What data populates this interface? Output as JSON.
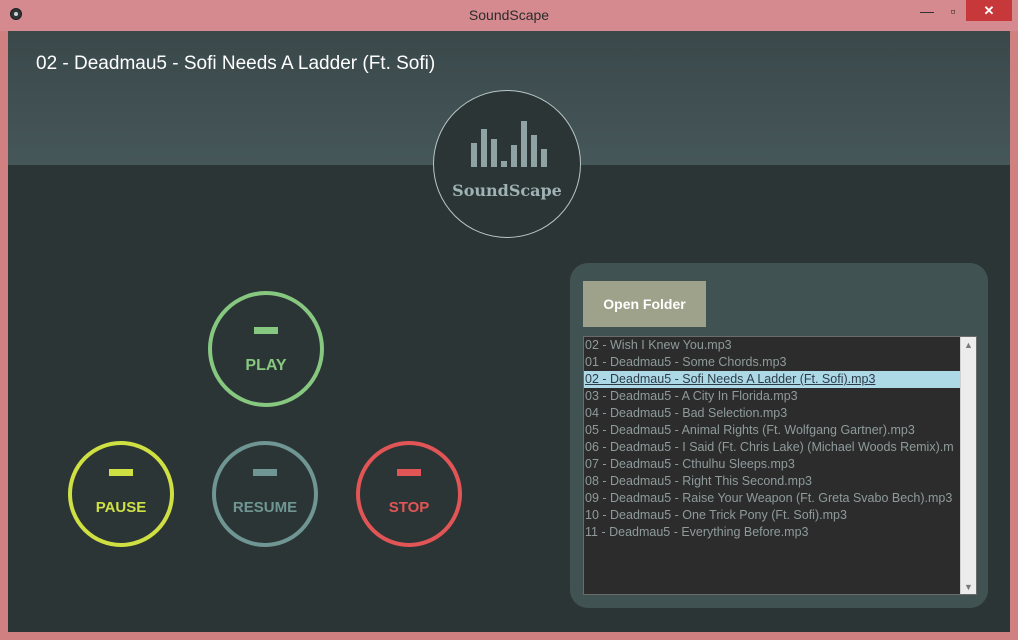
{
  "window": {
    "title": "SoundScape",
    "icons": {
      "app": "app-icon",
      "minimize": "minimize-icon",
      "maximize": "maximize-icon",
      "close": "close-icon"
    },
    "minimize_glyph": "—",
    "maximize_glyph": "▫",
    "close_glyph": "✕"
  },
  "header": {
    "now_playing": "02 - Deadmau5 - Sofi Needs A Ladder (Ft. Sofi)"
  },
  "logo": {
    "text": "SoundScape",
    "icon": "equalizer-bars-icon"
  },
  "controls": {
    "play": {
      "label": "PLAY",
      "color": "#87c880"
    },
    "pause": {
      "label": "PAUSE",
      "color": "#cfe142"
    },
    "resume": {
      "label": "RESUME",
      "color": "#6f9693"
    },
    "stop": {
      "label": "STOP",
      "color": "#e25556"
    }
  },
  "playlist": {
    "open_folder_label": "Open Folder",
    "selected_index": 2,
    "items": [
      "02 - Wish I Knew You.mp3",
      "01 - Deadmau5 - Some Chords.mp3",
      "02 - Deadmau5 - Sofi Needs A Ladder (Ft. Sofi).mp3",
      "03 - Deadmau5 - A City In Florida.mp3",
      "04 - Deadmau5 - Bad Selection.mp3",
      "05 - Deadmau5 - Animal Rights (Ft. Wolfgang Gartner).mp3",
      "06 - Deadmau5 - I Said (Ft. Chris Lake) (Michael Woods Remix).m",
      "07 - Deadmau5 - Cthulhu Sleeps.mp3",
      "08 - Deadmau5 - Right This Second.mp3",
      "09 - Deadmau5 - Raise Your Weapon (Ft. Greta Svabo Bech).mp3",
      "10 - Deadmau5 - One Trick Pony (Ft. Sofi).mp3",
      "11 - Deadmau5 - Everything Before.mp3"
    ],
    "scroll_up_glyph": "▲",
    "scroll_down_glyph": "▼"
  }
}
